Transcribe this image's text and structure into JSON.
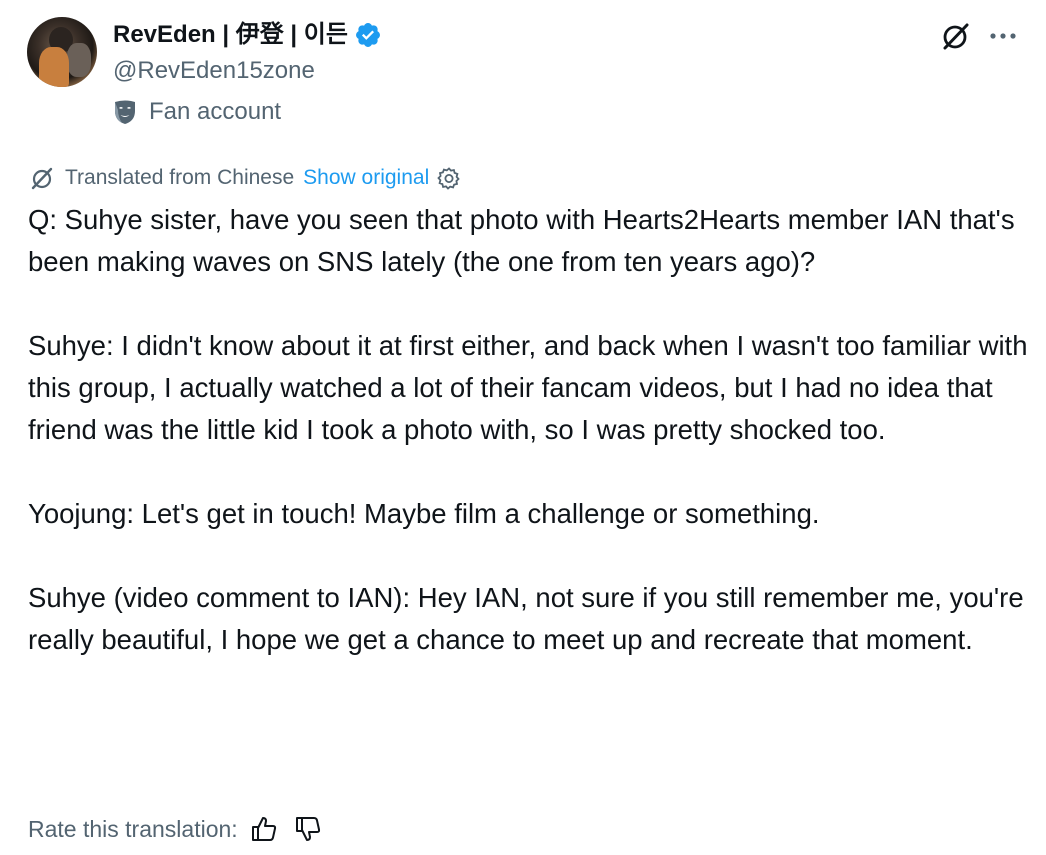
{
  "author": {
    "display_name": "RevEden | 伊登 | 이든",
    "handle": "@RevEden15zone",
    "label": "Fan account",
    "verified_color": "#1d9bf0"
  },
  "header_actions": {
    "grok_icon": "grok-icon",
    "more_icon": "more-icon"
  },
  "translation": {
    "notice": "Translated from Chinese",
    "show_original": "Show original"
  },
  "tweet": {
    "paragraphs": [
      "Q: Suhye sister, have you seen that photo with Hearts2Hearts member IAN that's been making waves on SNS lately (the one from ten years ago)?",
      "Suhye: I didn't know about it at first either, and back when I wasn't too familiar with this group, I actually watched a lot of their fancam videos, but I had no idea that friend was the little kid I took a photo with, so I was pretty shocked too.",
      "Yoojung: Let's get in touch! Maybe film a challenge or something.",
      "Suhye (video comment to IAN): Hey IAN, not sure if you still remember me, you're really beautiful, I hope we get a chance to meet up and recreate that moment."
    ]
  },
  "rating": {
    "label": "Rate this translation:"
  }
}
